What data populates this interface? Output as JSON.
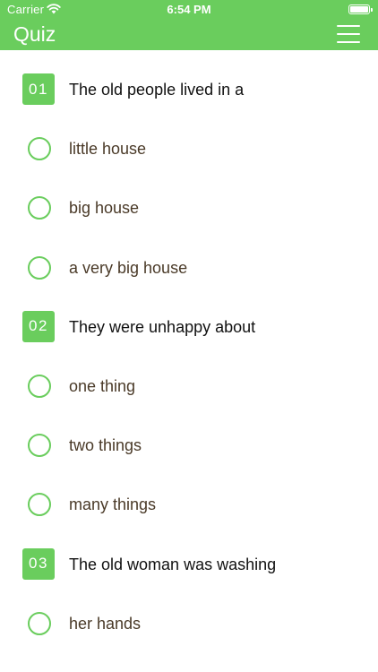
{
  "status_bar": {
    "carrier": "Carrier",
    "time": "6:54 PM",
    "wifi_icon": "wifi-icon",
    "battery_icon": "battery-icon"
  },
  "nav": {
    "title": "Quiz",
    "menu_icon": "hamburger-menu-icon"
  },
  "colors": {
    "accent": "#6acd5d",
    "question_text": "#111111",
    "option_text": "#4a3a28",
    "background": "#ffffff"
  },
  "questions": [
    {
      "number": "01",
      "text": "The old people lived in a",
      "options": [
        "little house",
        "big house",
        "a very big house"
      ]
    },
    {
      "number": "02",
      "text": "They were unhappy about",
      "options": [
        "one thing",
        "two things",
        "many things"
      ]
    },
    {
      "number": "03",
      "text": "The old woman was washing",
      "options": [
        "her hands"
      ]
    }
  ]
}
